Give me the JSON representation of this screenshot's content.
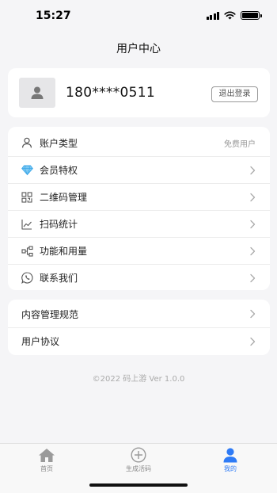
{
  "status_bar": {
    "time": "15:27"
  },
  "header": {
    "title": "用户中心"
  },
  "profile": {
    "avatar_icon": "user-icon",
    "phone": "180****0511",
    "logout_label": "退出登录"
  },
  "menu": {
    "items": [
      {
        "icon": "user-icon",
        "label": "账户类型",
        "value": "免费用户"
      },
      {
        "icon": "diamond-icon",
        "label": "会员特权"
      },
      {
        "icon": "qrcode-icon",
        "label": "二维码管理"
      },
      {
        "icon": "line-chart-icon",
        "label": "扫码统计"
      },
      {
        "icon": "nodes-icon",
        "label": "功能和用量"
      },
      {
        "icon": "phone-chat-icon",
        "label": "联系我们"
      }
    ]
  },
  "legal": {
    "items": [
      {
        "label": "内容管理规范"
      },
      {
        "label": "用户协议"
      }
    ]
  },
  "footer": {
    "copyright": "©2022 码上游 Ver 1.0.0"
  },
  "tabbar": {
    "active_color": "#2e7bf6",
    "tabs": [
      {
        "icon": "home-icon",
        "label": "首页"
      },
      {
        "icon": "plus-circle-icon",
        "label": "生成活码"
      },
      {
        "icon": "user-icon",
        "label": "我的",
        "active": true
      }
    ]
  }
}
